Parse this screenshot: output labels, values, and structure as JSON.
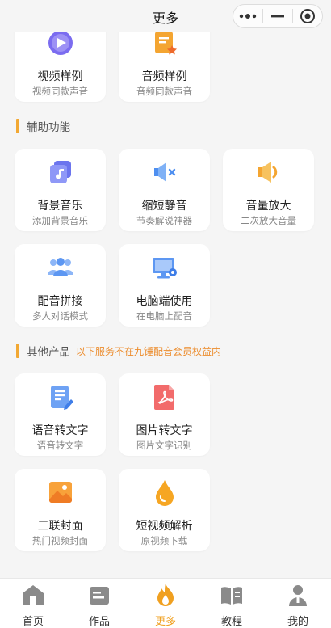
{
  "header": {
    "title": "更多"
  },
  "capsule": {
    "more_icon": "more-dots-icon",
    "minimize_icon": "minimize-icon",
    "close_icon": "target-close-icon"
  },
  "top_cards": [
    {
      "name": "视频样例",
      "sub": "视频同款声音",
      "icon": "video-play-icon"
    },
    {
      "name": "音频样例",
      "sub": "音频同款声音",
      "icon": "audio-doc-icon"
    }
  ],
  "sections": {
    "aux": {
      "label": "辅助功能"
    },
    "other": {
      "label": "其他产品",
      "note": "以下服务不在九锤配音会员权益内"
    }
  },
  "aux_cards": [
    {
      "name": "背景音乐",
      "sub": "添加背景音乐",
      "icon": "music-note-icon"
    },
    {
      "name": "缩短静音",
      "sub": "节奏解说神器",
      "icon": "mute-speaker-icon"
    },
    {
      "name": "音量放大",
      "sub": "二次放大音量",
      "icon": "volume-up-icon"
    },
    {
      "name": "配音拼接",
      "sub": "多人对话模式",
      "icon": "people-group-icon"
    },
    {
      "name": "电脑端使用",
      "sub": "在电脑上配音",
      "icon": "desktop-computer-icon"
    }
  ],
  "other_cards": [
    {
      "name": "语音转文字",
      "sub": "语音转文字",
      "icon": "document-edit-icon"
    },
    {
      "name": "图片转文字",
      "sub": "图片文字识别",
      "icon": "pdf-file-icon"
    },
    {
      "name": "三联封面",
      "sub": "热门视频封面",
      "icon": "image-icon"
    },
    {
      "name": "短视频解析",
      "sub": "原视频下载",
      "icon": "water-drop-icon"
    }
  ],
  "tabs": [
    {
      "label": "首页",
      "icon": "home-icon",
      "active": false
    },
    {
      "label": "作品",
      "icon": "works-icon",
      "active": false
    },
    {
      "label": "更多",
      "icon": "fire-icon",
      "active": true
    },
    {
      "label": "教程",
      "icon": "book-icon",
      "active": false
    },
    {
      "label": "我的",
      "icon": "user-icon",
      "active": false
    }
  ],
  "colors": {
    "accent": "#f2a833",
    "note": "#ec8c2c",
    "active_tab": "#f0a020"
  }
}
